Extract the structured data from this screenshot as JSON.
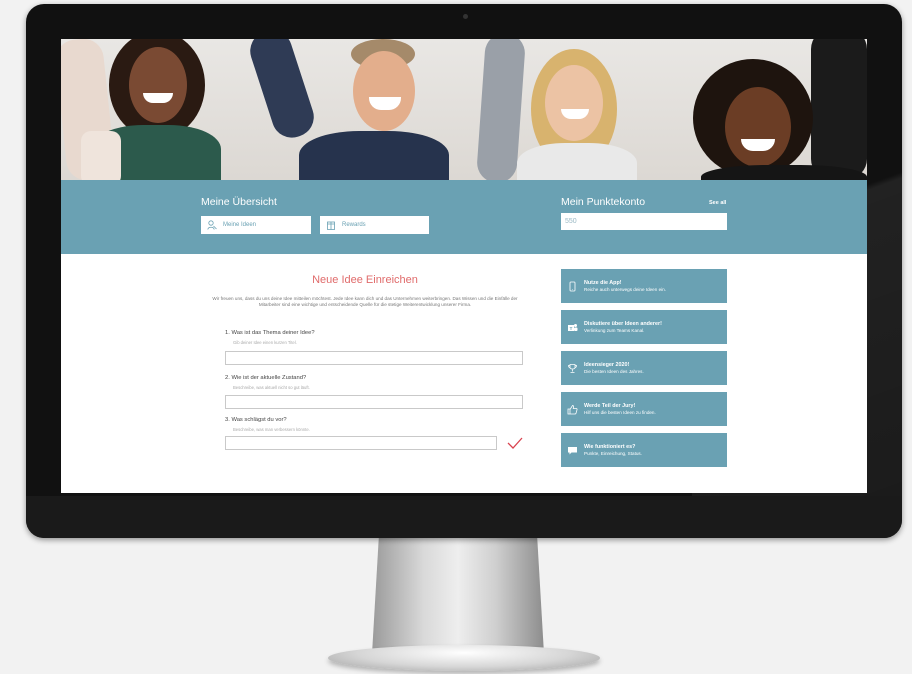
{
  "hero": {
    "alt": "banner-photo"
  },
  "overview": {
    "title": "Meine Übersicht",
    "my_ideas_label": "Meine Ideen",
    "rewards_label": "Rewards"
  },
  "points": {
    "title": "Mein Punktekonto",
    "see_all": "See all",
    "value": "550"
  },
  "form": {
    "title": "Neue Idee Einreichen",
    "intro": "Wir freuen uns, dass du uns deine Idee mitteilen möchtest. Jede Idee kann dich und das Unternehmen weiterbringen. Das Wissen und die Einfälle der Mitarbeiter sind eine wichtige und entscheidende Quelle für die stetige Weiterentwicklung unserer Firma.",
    "questions": [
      {
        "label": "1. Was ist das Thema deiner Idee?",
        "hint": "Gib deiner Idee einen kurzen Titel.",
        "value": ""
      },
      {
        "label": "2. Wie ist der aktuelle Zustand?",
        "hint": "Beschreibe, was aktuell nicht so gut läuft.",
        "value": ""
      },
      {
        "label": "3. Was schlägst du vor?",
        "hint": "Beschreibe, was man verbessern könnte.",
        "value": ""
      }
    ]
  },
  "tiles": [
    {
      "title": "Nutze die App!",
      "subtitle": "Reiche auch unterwegs deine Ideen ein.",
      "icon": "phone-icon"
    },
    {
      "title": "Diskutiere über Ideen anderer!",
      "subtitle": "Verlinkung zum Teams Kanal.",
      "icon": "teams-icon"
    },
    {
      "title": "Ideensieger 2020!",
      "subtitle": "Die besten Ideen des Jahres.",
      "icon": "trophy-icon"
    },
    {
      "title": "Werde Teil der Jury!",
      "subtitle": "Hilf uns die besten Ideen zu finden.",
      "icon": "thumbs-up-icon"
    },
    {
      "title": "Wie funktioniert es?",
      "subtitle": "Punkte, Einreichung, Status.",
      "icon": "chat-icon"
    }
  ],
  "colors": {
    "accent": "#6aa1b3",
    "title_red": "#e06b6b",
    "check_red": "#d9434f"
  }
}
